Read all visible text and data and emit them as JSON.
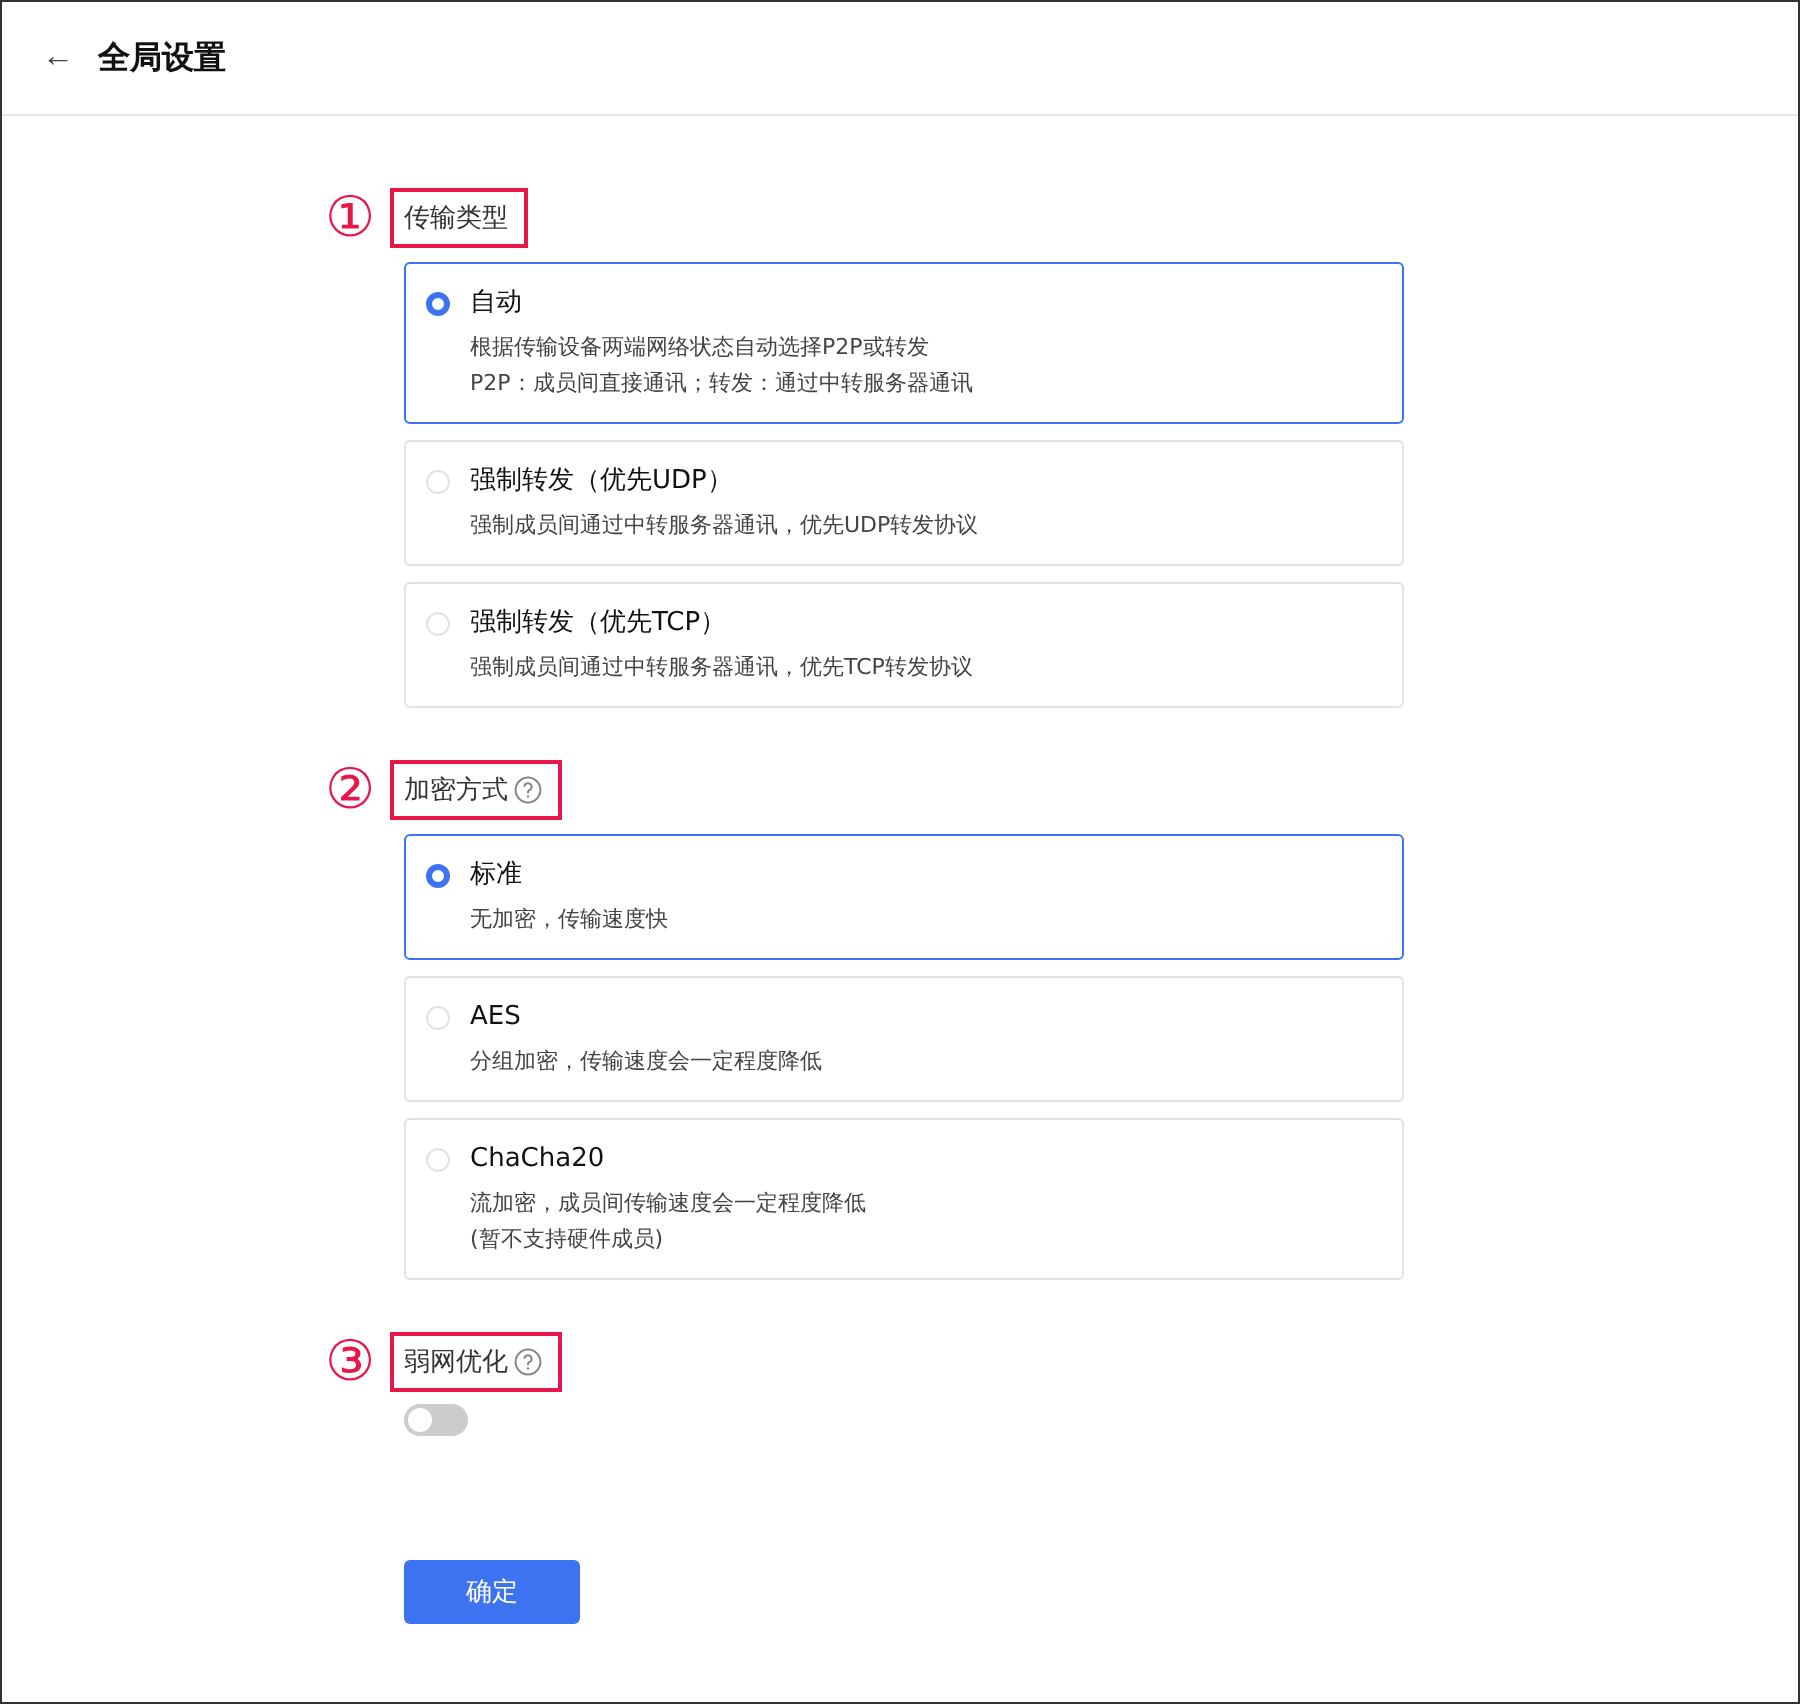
{
  "header": {
    "back": "←",
    "title": "全局设置"
  },
  "sections": [
    {
      "marker": "①",
      "label": "传输类型",
      "help": false,
      "kind": "radio",
      "options": [
        {
          "title": "自动",
          "selected": true,
          "lines": [
            "根据传输设备两端网络状态自动选择P2P或转发",
            "P2P：成员间直接通讯；转发：通过中转服务器通讯"
          ]
        },
        {
          "title": "强制转发（优先UDP）",
          "selected": false,
          "lines": [
            "强制成员间通过中转服务器通讯，优先UDP转发协议"
          ]
        },
        {
          "title": "强制转发（优先TCP）",
          "selected": false,
          "lines": [
            "强制成员间通过中转服务器通讯，优先TCP转发协议"
          ]
        }
      ]
    },
    {
      "marker": "②",
      "label": "加密方式",
      "help": true,
      "kind": "radio",
      "options": [
        {
          "title": "标准",
          "selected": true,
          "lines": [
            "无加密，传输速度快"
          ]
        },
        {
          "title": "AES",
          "selected": false,
          "lines": [
            "分组加密，传输速度会一定程度降低"
          ]
        },
        {
          "title": "ChaCha20",
          "selected": false,
          "lines": [
            "流加密，成员间传输速度会一定程度降低",
            "(暂不支持硬件成员)"
          ]
        }
      ]
    },
    {
      "marker": "③",
      "label": "弱网优化",
      "help": true,
      "kind": "toggle",
      "on": false
    }
  ],
  "confirm": "确定"
}
